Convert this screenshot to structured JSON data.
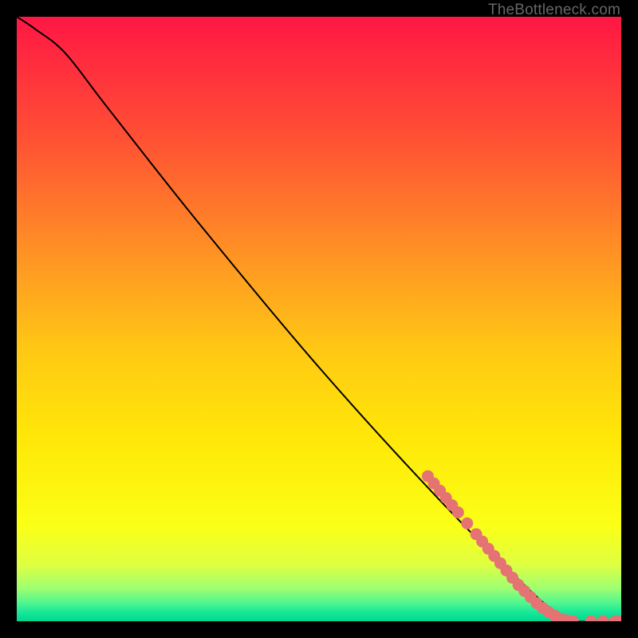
{
  "attribution": "TheBottleneck.com",
  "chart_data": {
    "type": "line",
    "title": "",
    "xlabel": "",
    "ylabel": "",
    "xlim": [
      0,
      100
    ],
    "ylim": [
      0,
      100
    ],
    "curve": [
      {
        "x": 0,
        "y": 100
      },
      {
        "x": 3,
        "y": 98
      },
      {
        "x": 8,
        "y": 94
      },
      {
        "x": 15,
        "y": 85
      },
      {
        "x": 30,
        "y": 66
      },
      {
        "x": 50,
        "y": 42
      },
      {
        "x": 70,
        "y": 20
      },
      {
        "x": 85,
        "y": 5
      },
      {
        "x": 90,
        "y": 1
      },
      {
        "x": 92,
        "y": 0
      },
      {
        "x": 100,
        "y": 0
      }
    ],
    "markers": [
      {
        "x": 68,
        "y": 24.0
      },
      {
        "x": 69,
        "y": 22.8
      },
      {
        "x": 70,
        "y": 21.6
      },
      {
        "x": 71,
        "y": 20.4
      },
      {
        "x": 72,
        "y": 19.2
      },
      {
        "x": 73,
        "y": 18.0
      },
      {
        "x": 74.5,
        "y": 16.2
      },
      {
        "x": 76,
        "y": 14.4
      },
      {
        "x": 77,
        "y": 13.2
      },
      {
        "x": 78,
        "y": 12.0
      },
      {
        "x": 79,
        "y": 10.8
      },
      {
        "x": 80,
        "y": 9.6
      },
      {
        "x": 81,
        "y": 8.4
      },
      {
        "x": 82,
        "y": 7.2
      },
      {
        "x": 83,
        "y": 6.0
      },
      {
        "x": 84,
        "y": 5.0
      },
      {
        "x": 85,
        "y": 4.0
      },
      {
        "x": 86,
        "y": 3.0
      },
      {
        "x": 87,
        "y": 2.2
      },
      {
        "x": 88,
        "y": 1.5
      },
      {
        "x": 89,
        "y": 0.9
      },
      {
        "x": 90,
        "y": 0.4
      },
      {
        "x": 91,
        "y": 0.15
      },
      {
        "x": 92,
        "y": 0
      },
      {
        "x": 95,
        "y": 0
      },
      {
        "x": 97,
        "y": 0
      },
      {
        "x": 99,
        "y": 0
      },
      {
        "x": 100,
        "y": 0
      }
    ],
    "marker_color": "#e57373",
    "gradient_stops": [
      {
        "offset": 0.0,
        "color": "#ff1744"
      },
      {
        "offset": 0.2,
        "color": "#ff5034"
      },
      {
        "offset": 0.4,
        "color": "#ff9524"
      },
      {
        "offset": 0.55,
        "color": "#ffc814"
      },
      {
        "offset": 0.7,
        "color": "#ffe808"
      },
      {
        "offset": 0.84,
        "color": "#fbff15"
      },
      {
        "offset": 0.905,
        "color": "#e0ff40"
      },
      {
        "offset": 0.945,
        "color": "#a0ff70"
      },
      {
        "offset": 0.97,
        "color": "#50f590"
      },
      {
        "offset": 0.985,
        "color": "#18e898"
      },
      {
        "offset": 1.0,
        "color": "#00d890"
      }
    ]
  }
}
